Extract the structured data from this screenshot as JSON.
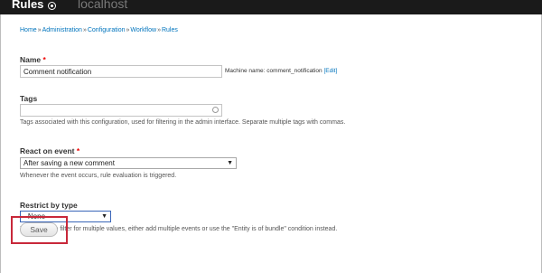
{
  "header": {
    "title": "Rules",
    "host": "localhost"
  },
  "breadcrumb": {
    "items": [
      "Home",
      "Administration",
      "Configuration",
      "Workflow",
      "Rules"
    ],
    "separator": "»"
  },
  "form": {
    "name": {
      "label": "Name",
      "required_mark": "*",
      "value": "Comment notification",
      "machine_name_prefix": "Machine name: comment_notification",
      "edit_link": "[Edit]"
    },
    "tags": {
      "label": "Tags",
      "value": "",
      "description": "Tags associated with this configuration, used for filtering in the admin interface. Separate multiple tags with commas."
    },
    "react_on_event": {
      "label": "React on event",
      "required_mark": "*",
      "selected": "After saving a new comment",
      "description": "Whenever the event occurs, rule evaluation is triggered."
    },
    "restrict_by_type": {
      "label": "Restrict by type",
      "selected": "- None -",
      "description": "If you need to filter for multiple values, either add multiple events or use the \"Entity is of bundle\" condition instead."
    },
    "save_label": "Save"
  },
  "colors": {
    "link": "#0074bd",
    "required": "#e00000",
    "highlight_box": "#c8283a",
    "header_bg": "#1a1a1a"
  }
}
